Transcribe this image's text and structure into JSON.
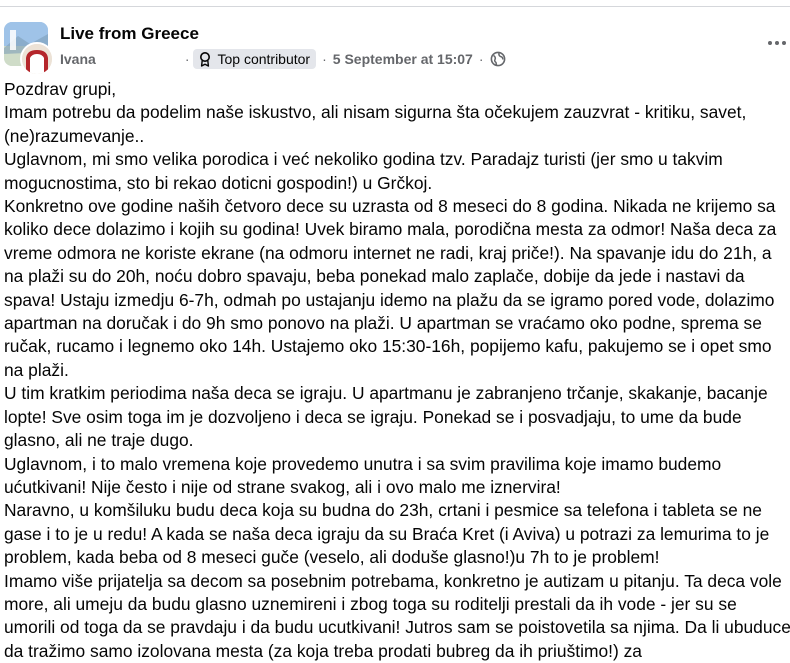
{
  "post": {
    "group_name": "Live from Greece",
    "author": "Ivana",
    "badge_label": "Top contributor",
    "timestamp": "5 September at 15:07",
    "separator": "·",
    "privacy_icon": "globe-icon",
    "more_icon": "more-options-icon",
    "badge_icon": "contributor-badge-icon",
    "paragraphs": [
      "Pozdrav grupi,",
      "Imam potrebu da podelim naše iskustvo, ali nisam sigurna šta očekujem zauzvrat - kritiku, savet, (ne)razumevanje..",
      "Uglavnom, mi smo velika porodica i već nekoliko godina tzv. Paradajz turisti (jer smo u takvim mogucnostima, sto bi rekao doticni gospodin!) u Grčkoj.",
      "Konkretno ove godine naših četvoro dece su uzrasta od 8 meseci do 8 godina. Nikada ne krijemo sa koliko dece dolazimo i kojih su godina! Uvek biramo mala, porodična mesta za odmor! Naša deca za vreme odmora ne koriste ekrane (na odmoru internet ne radi, kraj priče!). Na spavanje idu do 21h, a na plaži su do 20h, noću dobro spavaju, beba ponekad malo zaplače, dobije da jede i nastavi da spava! Ustaju izmedju 6-7h, odmah po ustajanju idemo na plažu da se igramo pored vode, dolazimo apartman na doručak i do 9h smo ponovo na plaži. U apartman se vraćamo oko podne, sprema se ručak, rucamo i legnemo oko 14h. Ustajemo oko 15:30-16h, popijemo kafu, pakujemo se i opet smo na plaži.",
      "U tim kratkim periodima naša deca se igraju. U apartmanu je zabranjeno trčanje, skakanje, bacanje lopte! Sve osim toga im je dozvoljeno i deca se igraju. Ponekad se i posvadjaju, to ume da bude glasno, ali ne traje dugo.",
      "Uglavnom, i to malo vremena koje provedemo unutra i sa svim pravilima koje imamo budemo ućutkivani! Nije često i nije od strane svakog, ali i ovo malo me iznervira!",
      "Naravno, u komšiluku budu deca koja su budna do 23h, crtani i pesmice sa telefona i tableta se ne gase i to je u redu! A kada se naša deca igraju da su Braća Kret (i Aviva) u potrazi za lemurima to je problem, kada beba od 8 meseci guče (veselo, ali doduše glasno!)u 7h to je problem!",
      "Imamo više prijatelja sa decom sa posebnim potrebama, konkretno je autizam u pitanju. Ta deca vole more, ali umeju da budu glasno uznemireni i zbog toga su roditelji prestali da ih vode - jer su se umorili od toga da se pravdaju i da budu ucutkivani! Jutros sam se poistovetila sa njima. Da li ubuduce da tražimo samo izolovana mesta (za koja treba prodati bubreg da ih priuštimo!) za"
    ]
  }
}
